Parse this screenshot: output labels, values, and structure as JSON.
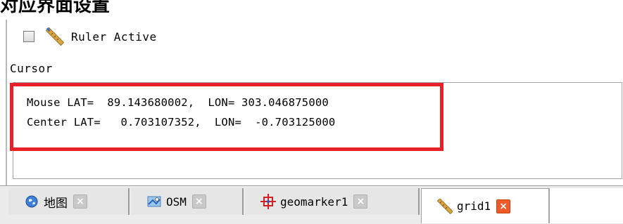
{
  "heading": "对应界面设置",
  "ruler": {
    "label": "Ruler Active",
    "checked": false,
    "icon": "ruler-icon"
  },
  "cursor": {
    "section_label": "Cursor",
    "mouse_line": "Mouse LAT=  89.143680002,  LON= 303.046875000",
    "center_line": "Center LAT=   0.703107352,  LON=  -0.703125000"
  },
  "tabs": [
    {
      "label": "地图",
      "icon": "globe-icon",
      "active": false
    },
    {
      "label": "OSM",
      "icon": "map-icon",
      "active": false
    },
    {
      "label": "geomarker1",
      "icon": "crosshair-icon",
      "active": false
    },
    {
      "label": "grid1",
      "icon": "ruler-icon",
      "active": true
    }
  ],
  "close_glyph": "×",
  "colors": {
    "highlight": "#e8202a",
    "close_active": "#f05a28",
    "close_inactive": "#c9c9c9"
  }
}
